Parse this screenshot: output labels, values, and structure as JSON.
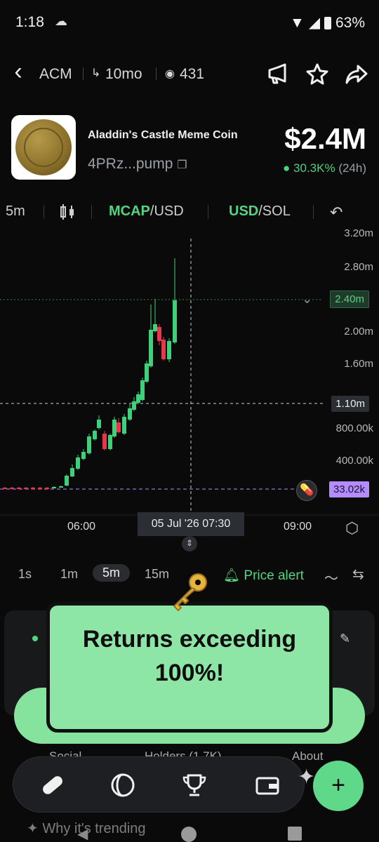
{
  "status_bar": {
    "time": "1:18",
    "battery": "63%"
  },
  "header": {
    "ticker": "ACM",
    "age": "10mo",
    "views": "431"
  },
  "token": {
    "name": "Aladdin's Castle Meme Coin",
    "address": "4PRz...pump",
    "market_cap": "$2.4M",
    "change": "30.3K%",
    "change_period": "(24h)"
  },
  "chart_toolbar": {
    "interval": "5m",
    "mcap_label": "MCAP",
    "mcap_suffix": "/USD",
    "usd_label": "USD",
    "usd_suffix": "/SOL"
  },
  "chart": {
    "y_ticks": [
      "3.20m",
      "2.80m",
      "2.40m",
      "2.00m",
      "1.60m",
      "1.10m",
      "800.00k",
      "400.00k",
      "33.02k"
    ],
    "current_price_tag": "2.40m",
    "crosshair_tag": "1.10m",
    "baseline_tag": "33.02k",
    "x_ticks": [
      "06:00",
      "09:00"
    ],
    "crosshair_date": "05 Jul '26  07:30",
    "colors": {
      "up": "#3fd17a",
      "down": "#e8374a",
      "baseline": "#b58cff"
    }
  },
  "timeframes": [
    "1s",
    "1m",
    "5m",
    "15m"
  ],
  "active_timeframe": "5m",
  "price_alert": "Price alert",
  "overlay": {
    "message": "Returns exceeding\n100%!"
  },
  "bottom_tabs": [
    "Social",
    "Holders (1.7K)",
    "About"
  ],
  "trending": "Why it's trending"
}
